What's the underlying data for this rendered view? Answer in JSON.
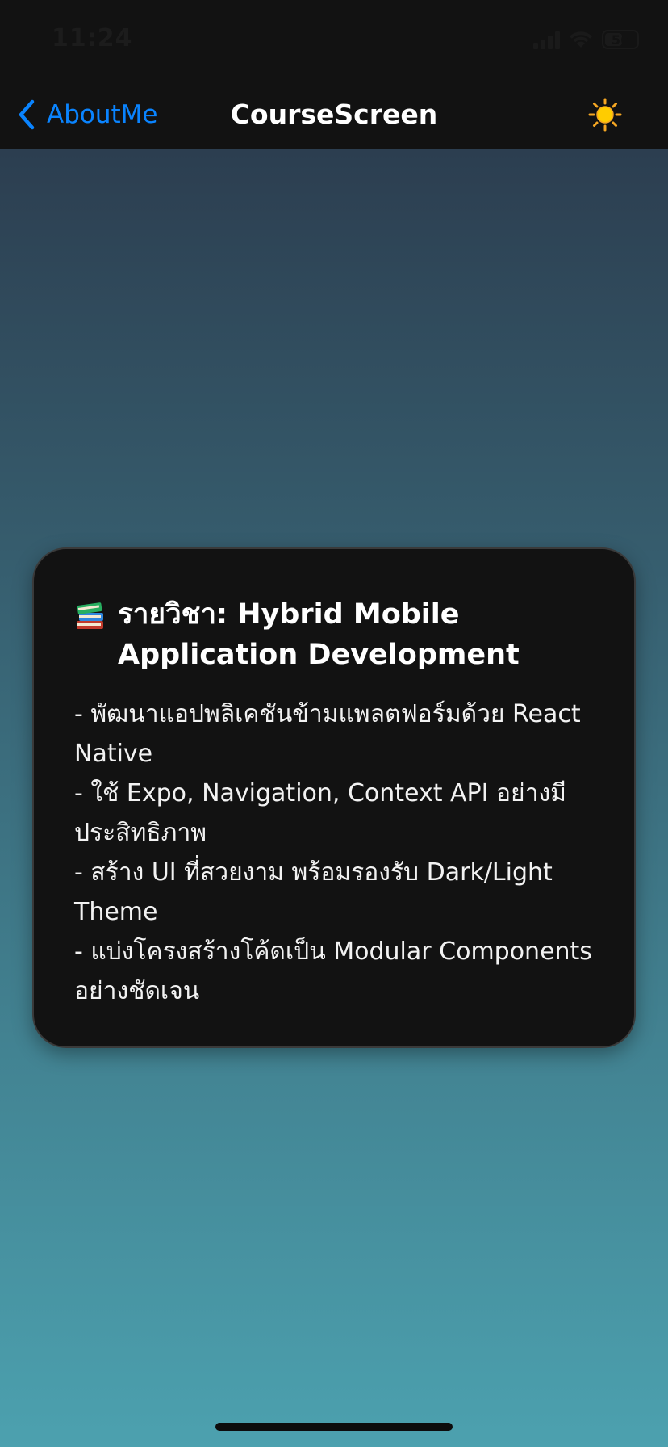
{
  "status_bar": {
    "time": "11:24",
    "battery_level": "56",
    "battery_fill_fraction": 0.56,
    "icons": [
      "signal-icon",
      "wifi-icon",
      "battery-icon"
    ]
  },
  "nav": {
    "back_label": "AboutMe",
    "title": "CourseScreen",
    "back_icon": "chevron-left-icon",
    "theme_icon": "sun-icon",
    "accent_color": "#0a84ff"
  },
  "background": {
    "gradient_top": "#2c3e50",
    "gradient_bottom": "#4ca1af"
  },
  "course_card": {
    "icon": "books-icon",
    "title": "รายวิชา: Hybrid Mobile Application Development",
    "description_lines": [
      "- พัฒนาแอปพลิเคชันข้ามแพลตฟอร์มด้วย React",
      "Native",
      "- ใช้ Expo, Navigation, Context API อย่างมี",
      "ประสิทธิภาพ",
      "- สร้าง UI ที่สวยงาม พร้อมรองรับ Dark/Light",
      "Theme",
      "- แบ่งโครงสร้างโค้ดเป็น Modular Components",
      "อย่างชัดเจน"
    ]
  }
}
